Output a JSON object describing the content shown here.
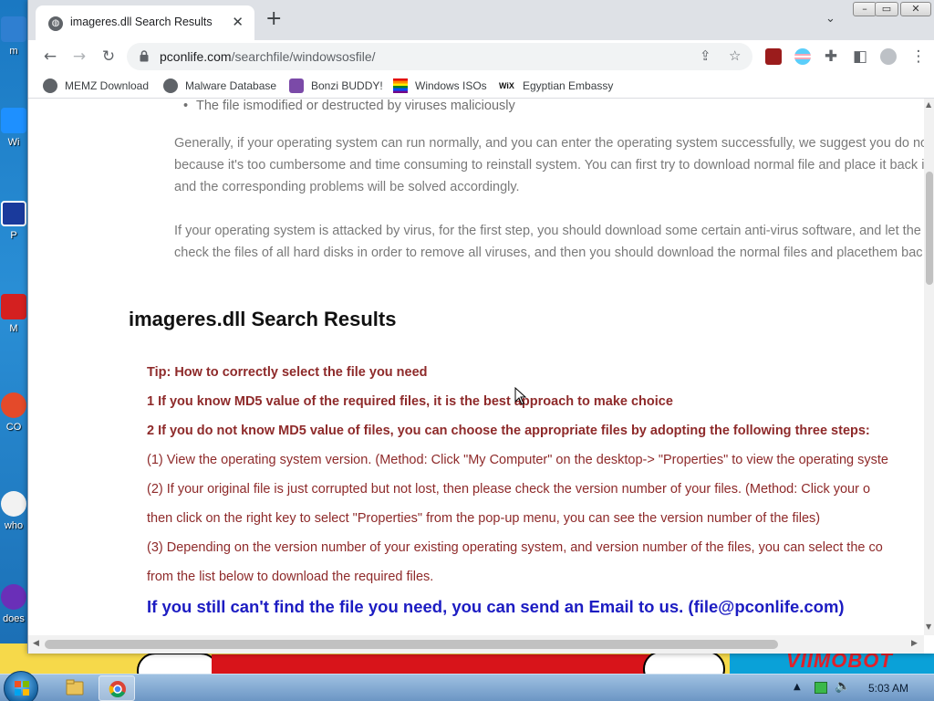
{
  "desktop": {
    "icons": [
      {
        "label": "m",
        "color": "#2f7fd1"
      },
      {
        "label": "Wi",
        "color": "#1e90ff"
      },
      {
        "label": "P",
        "color": "#1a3a9c"
      },
      {
        "label": "M",
        "color": "#d42020"
      },
      {
        "label": "CO",
        "color": "#e44a2a"
      },
      {
        "label": "who",
        "color": "#f2f2f2"
      },
      {
        "label": "does",
        "color": "#6a2fb8"
      }
    ],
    "wallpaper_logo": "VIIMOBOT"
  },
  "browser": {
    "tab_title": "imageres.dll Search Results",
    "url_host": "pconlife.com",
    "url_path": "/searchfile/windowsosfile/",
    "bookmarks": [
      {
        "label": "MEMZ Download",
        "icon": "globe-icon"
      },
      {
        "label": "Malware Database",
        "icon": "globe-icon"
      },
      {
        "label": "Bonzi BUDDY!",
        "icon": "bonzi-icon"
      },
      {
        "label": "Windows ISOs",
        "icon": "rainbow-flag-icon"
      },
      {
        "label": "Egyptian Embassy",
        "icon": "wix-icon"
      }
    ],
    "window_controls": {
      "minimize": "–",
      "restore": "▭",
      "close": "✕"
    }
  },
  "page": {
    "bullet_item": "The file ismodified or destructed by viruses maliciously",
    "para1": [
      "Generally, if your operating system can run normally, and you can enter the operating system successfully, we suggest you do not",
      "because it's too cumbersome and time consuming to reinstall system. You can first try to download normal file and place it back i",
      "and the corresponding problems will be solved accordingly."
    ],
    "para2": [
      "If your operating system is attacked by virus, for the first step, you should download some certain anti-virus software, and let the",
      "check the files of all hard disks in order to remove all viruses, and then you should download the normal files and placethem bac"
    ],
    "results_title": "imageres.dll Search Results",
    "tip_title": "Tip: How to correctly select the file you need",
    "tip1": "1 If you know MD5 value of the required files, it is the best approach to make choice",
    "tip2": "2 If you do not know MD5 value of files, you can choose the appropriate files by adopting the following three steps:",
    "step1": " (1) View the operating system version. (Method: Click \"My Computer\" on the desktop-> \"Properties\" to view the operating syste",
    "step2a": " (2) If your original file is just corrupted but not lost, then please check the version number of your files. (Method: Click your o",
    "step2b": "then click on the right key to select \"Properties\" from the pop-up menu, you can see the version number of the files)",
    "step3a": " (3) Depending on the version number of your existing operating system, and version number of the files, you can select the co",
    "step3b": "from the list below to download the required files.",
    "email_line": "If you still can't find the file you need, you can send an Email to us. (file@pconlife.com)"
  },
  "taskbar": {
    "clock": "5:03 AM"
  },
  "colors": {
    "tip_red": "#8e2a2a",
    "email_blue": "#1c1cc2",
    "body_gray": "#7a7a7a"
  }
}
